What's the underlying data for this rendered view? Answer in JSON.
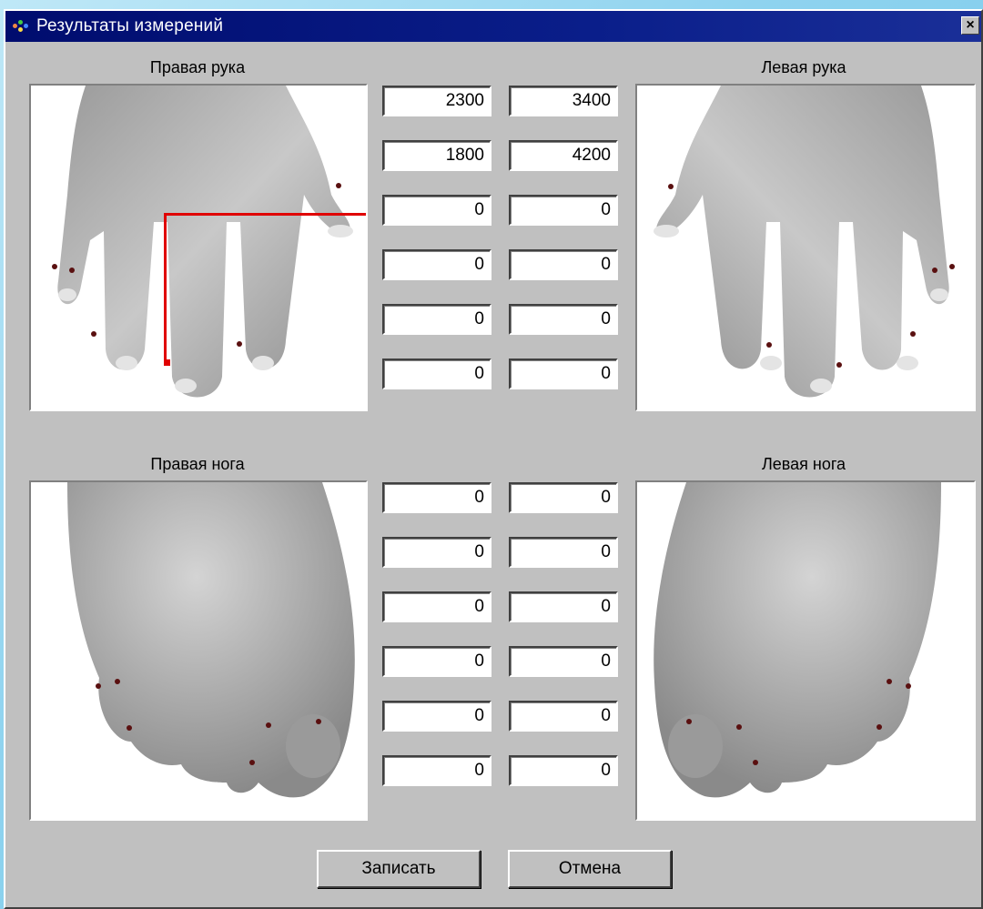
{
  "window": {
    "title": "Результаты измерений",
    "close_label": "×"
  },
  "labels": {
    "right_hand": "Правая рука",
    "left_hand": "Левая рука",
    "right_foot": "Правая нога",
    "left_foot": "Левая нога"
  },
  "hand_fields": {
    "rows": [
      [
        "2300",
        "3400"
      ],
      [
        "1800",
        "4200"
      ],
      [
        "0",
        "0"
      ],
      [
        "0",
        "0"
      ],
      [
        "0",
        "0"
      ],
      [
        "0",
        "0"
      ]
    ]
  },
  "foot_fields": {
    "rows": [
      [
        "0",
        "0"
      ],
      [
        "0",
        "0"
      ],
      [
        "0",
        "0"
      ],
      [
        "0",
        "0"
      ],
      [
        "0",
        "0"
      ],
      [
        "0",
        "0"
      ]
    ]
  },
  "buttons": {
    "save": "Записать",
    "cancel": "Отмена"
  },
  "colors": {
    "titlebar": "#000c6e",
    "dialog": "#c0c0c0",
    "pointer": "#e00000",
    "point_marker": "#5a1010"
  }
}
